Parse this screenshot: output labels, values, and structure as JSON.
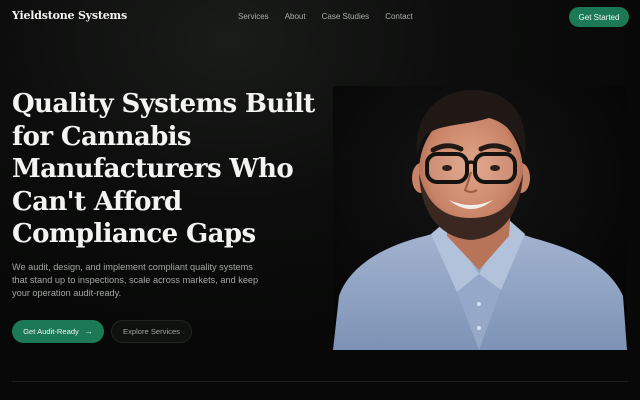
{
  "brand": {
    "name": "Yieldstone Systems"
  },
  "nav": {
    "links": [
      "Services",
      "About",
      "Case Studies",
      "Contact"
    ],
    "cta_label": "Get Started"
  },
  "hero": {
    "title_lines": [
      "Quality Systems Built",
      "for Cannabis",
      "Manufacturers Who",
      "Can't Afford",
      "Compliance Gaps"
    ],
    "subtitle_lines": [
      "We audit, design, and implement compliant quality systems",
      "that stand up to inspections, scale across markets, and keep",
      "your operation audit-ready."
    ],
    "primary_cta": "Get Audit-Ready",
    "primary_cta_icon": "arrow-right-icon",
    "secondary_cta": "Explore Services"
  },
  "colors": {
    "accent": "#1b7a55",
    "background": "#070807",
    "shirt": "#8ea3c4"
  }
}
